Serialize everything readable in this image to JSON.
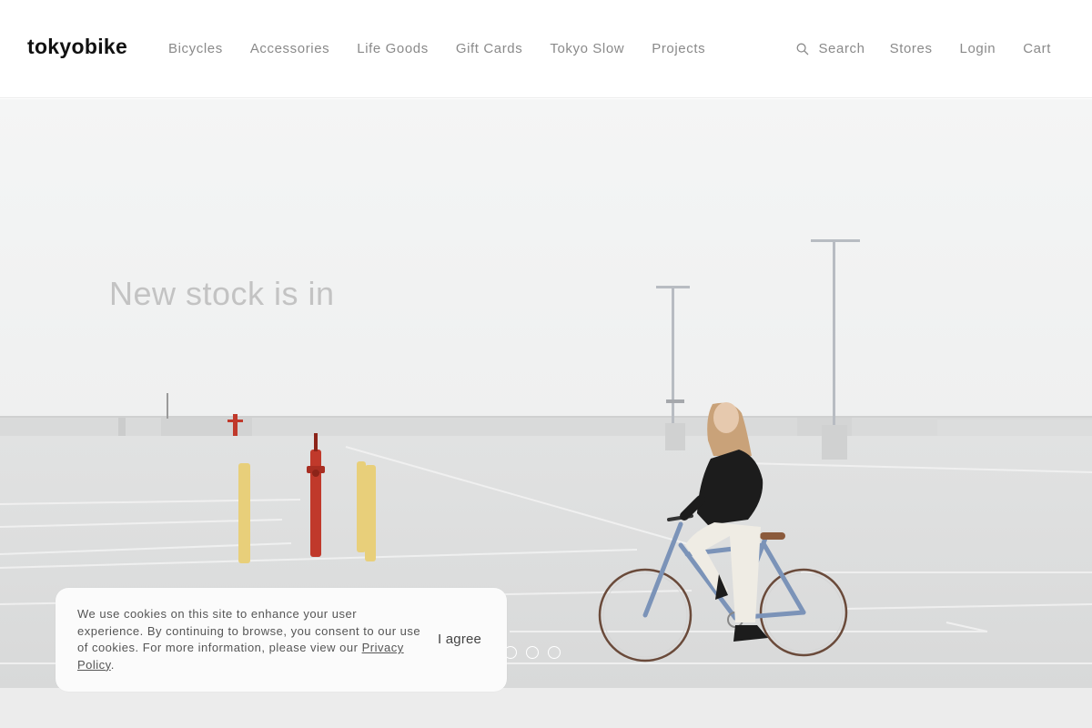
{
  "brand": {
    "logo_text": "tokyobike"
  },
  "nav": {
    "items": [
      "Bicycles",
      "Accessories",
      "Life Goods",
      "Gift Cards",
      "Tokyo Slow",
      "Projects"
    ]
  },
  "utility": {
    "search_label": "Search",
    "search_icon": "search-icon",
    "stores_label": "Stores",
    "login_label": "Login",
    "cart_label": "Cart"
  },
  "hero": {
    "headline": "New stock is in",
    "slide_count": 4,
    "active_slide": 1
  },
  "cookie_banner": {
    "text": "We use cookies on this site to enhance your user experience. By continuing to browse, you consent to our use of cookies. For more information, please view our ",
    "link_label": "Privacy Policy",
    "suffix": ".",
    "agree_label": "I agree"
  },
  "colors": {
    "headline": "#c3c3c3",
    "nav_text": "#8a8a8a",
    "logo": "#111111",
    "bike_frame": "#7b93b8",
    "hydrant": "#c0392b",
    "bollard": "#e8cf7a"
  }
}
